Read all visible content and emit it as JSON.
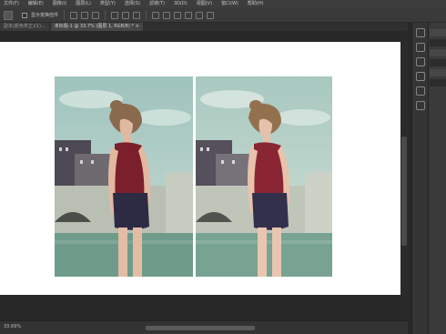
{
  "menu": [
    "文件(F)",
    "编辑(E)",
    "图像(I)",
    "图层(L)",
    "类型(Y)",
    "选择(S)",
    "滤镜(T)",
    "3D(D)",
    "视图(V)",
    "窗口(W)",
    "帮助(H)"
  ],
  "options": {
    "checkbox_label": "显示变换控件"
  },
  "tabs": [
    {
      "label": "副本(颜色校正)(1)..."
    },
    {
      "label": "未标题-1 @ 33.7% (图层 1, RGB/8) * ×"
    }
  ],
  "status": {
    "zoom": "33.69%"
  },
  "panels": [
    "",
    "",
    "",
    "",
    "",
    ""
  ],
  "colors": {
    "canvas": "#ffffff",
    "workspace": "#282828",
    "panel": "#3a3a3a"
  },
  "icons": [
    "move-tool-icon",
    "align-icon",
    "distribute-icon",
    "dock-expand-icon",
    "history-icon",
    "properties-icon",
    "brush-icon",
    "character-icon"
  ]
}
